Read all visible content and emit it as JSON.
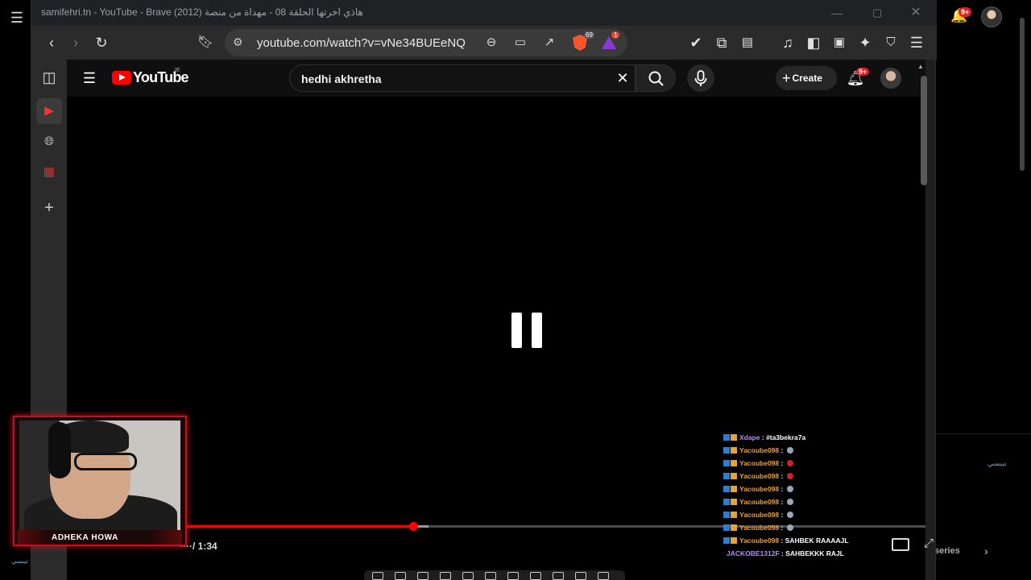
{
  "desktop": {
    "notification_badge": "9+",
    "series_tab": "series",
    "watermark": "تيبسي"
  },
  "browser": {
    "window_title": "samifehri.tn - YouTube - Brave هاذي اخرتها الحلقة 08 - مهداة من منصة (2012)",
    "url": "youtube.com/watch?v=vNe34BUEeNQ",
    "brave_shield_count": "69",
    "rewards_count": "1",
    "icons": {
      "back": "back-icon",
      "forward": "forward-icon",
      "reload": "reload-icon",
      "bookmark": "bookmark-icon"
    }
  },
  "youtube": {
    "logo_text": "YouTube",
    "country_code": "IE",
    "search_value": "hedhi akhretha",
    "create_label": "Create",
    "notification_badge": "9+",
    "player": {
      "state": "paused",
      "progress_fraction": 0.313,
      "buffered_fraction": 0.334,
      "time_display": "····/ 1:34"
    }
  },
  "webcam": {
    "label": "ADHEKA HOWA"
  },
  "chat": [
    {
      "user": "Xdape",
      "sep": " : ",
      "message": "#ta3bekra7a",
      "user_class": "user-xdape",
      "emote": ""
    },
    {
      "user": "Yacoube098",
      "sep": " : ",
      "message": "",
      "user_class": "user-yacoube",
      "emote": "#9aa7b8"
    },
    {
      "user": "Yacoube098",
      "sep": " : ",
      "message": "",
      "user_class": "user-yacoube",
      "emote": "#d02030"
    },
    {
      "user": "Yacoube098",
      "sep": " : ",
      "message": "",
      "user_class": "user-yacoube",
      "emote": "#d02030"
    },
    {
      "user": "Yacoube098",
      "sep": " : ",
      "message": "",
      "user_class": "user-yacoube",
      "emote": "#9aa7b8"
    },
    {
      "user": "Yacoube098",
      "sep": " : ",
      "message": "",
      "user_class": "user-yacoube",
      "emote": "#9aa7b8"
    },
    {
      "user": "Yacoube098",
      "sep": " : ",
      "message": "",
      "user_class": "user-yacoube",
      "emote": "#9aa7b8"
    },
    {
      "user": "Yacoube098",
      "sep": " : ",
      "message": "",
      "user_class": "user-yacoube",
      "emote": "#9aa7b8"
    },
    {
      "user": "Yacoube098",
      "sep": " : ",
      "message": "SAHBEK RAAAAJL",
      "user_class": "user-yacoube",
      "emote": ""
    },
    {
      "user": "JACKOBE1312F",
      "sep": " : ",
      "message": "SAHBEKKK RAJL",
      "user_class": "user-jacko",
      "emote": ""
    }
  ],
  "colors": {
    "youtube_red": "#ff0000",
    "progress_red": "#ff0000",
    "webcam_border": "#c1121f",
    "brave_orange": "#fb542b"
  }
}
